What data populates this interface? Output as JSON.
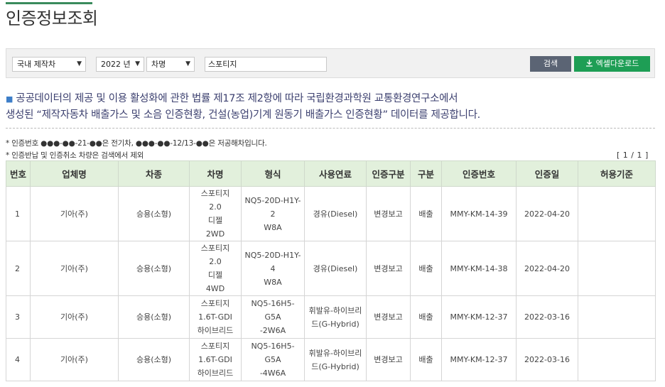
{
  "page": {
    "title": "인증정보조회"
  },
  "search": {
    "origin": "국내 제작차",
    "year": "2022 년",
    "field": "차명",
    "query": "스포티지",
    "search_label": "검색",
    "excel_label": "엑셀다운로드"
  },
  "notice": {
    "line1": "공공데이터의 제공 및 이용 활성화에 관한 법률 제17조 제2항에 따라 국립환경과학원 교통환경연구소에서",
    "line2": "생성된 “제작자동차 배출가스 및 소음 인증현황, 건설(농업)기계 원동기 배출가스 인증현황” 데이터를 제공합니다."
  },
  "footnotes": {
    "note1": "* 인증번호 ●●●-●●-21-●●은 전기차, ●●●-●●-12/13-●●은 저공해차입니다.",
    "note2": "* 인증반납 및 인증취소 차량은 검색에서 제외"
  },
  "pager": "[ 1 / 1 ]",
  "table": {
    "headers": [
      "번호",
      "업체명",
      "차종",
      "차명",
      "형식",
      "사용연료",
      "인증구분",
      "구분",
      "인증번호",
      "인증일",
      "허용기준"
    ],
    "rows": [
      {
        "no": "1",
        "maker": "기아(주)",
        "type": "승용(소형)",
        "name": [
          "스포티지",
          "2.0",
          "디젤",
          "2WD"
        ],
        "model": [
          "NQ5-20D-H1Y-2",
          "W8A"
        ],
        "fuel": [
          "경유(Diesel)"
        ],
        "cert_kind": "변경보고",
        "category": "배출",
        "cert_no": "MMY-KM-14-39",
        "date": "2022-04-20",
        "standard": ""
      },
      {
        "no": "2",
        "maker": "기아(주)",
        "type": "승용(소형)",
        "name": [
          "스포티지",
          "2.0",
          "디젤",
          "4WD"
        ],
        "model": [
          "NQ5-20D-H1Y-4",
          "W8A"
        ],
        "fuel": [
          "경유(Diesel)"
        ],
        "cert_kind": "변경보고",
        "category": "배출",
        "cert_no": "MMY-KM-14-38",
        "date": "2022-04-20",
        "standard": ""
      },
      {
        "no": "3",
        "maker": "기아(주)",
        "type": "승용(소형)",
        "name": [
          "스포티지",
          "1.6T-GDI",
          "하이브리드"
        ],
        "model": [
          "NQ5-16H5-G5A",
          "-2W6A"
        ],
        "fuel": [
          "휘발유-하이브리",
          "드(G-Hybrid)"
        ],
        "cert_kind": "변경보고",
        "category": "배출",
        "cert_no": "MMY-KM-12-37",
        "date": "2022-03-16",
        "standard": ""
      },
      {
        "no": "4",
        "maker": "기아(주)",
        "type": "승용(소형)",
        "name": [
          "스포티지",
          "1.6T-GDI",
          "하이브리드"
        ],
        "model": [
          "NQ5-16H5-G5A",
          "-4W6A"
        ],
        "fuel": [
          "휘발유-하이브리",
          "드(G-Hybrid)"
        ],
        "cert_kind": "변경보고",
        "category": "배출",
        "cert_no": "MMY-KM-12-37",
        "date": "2022-03-16",
        "standard": ""
      }
    ]
  }
}
